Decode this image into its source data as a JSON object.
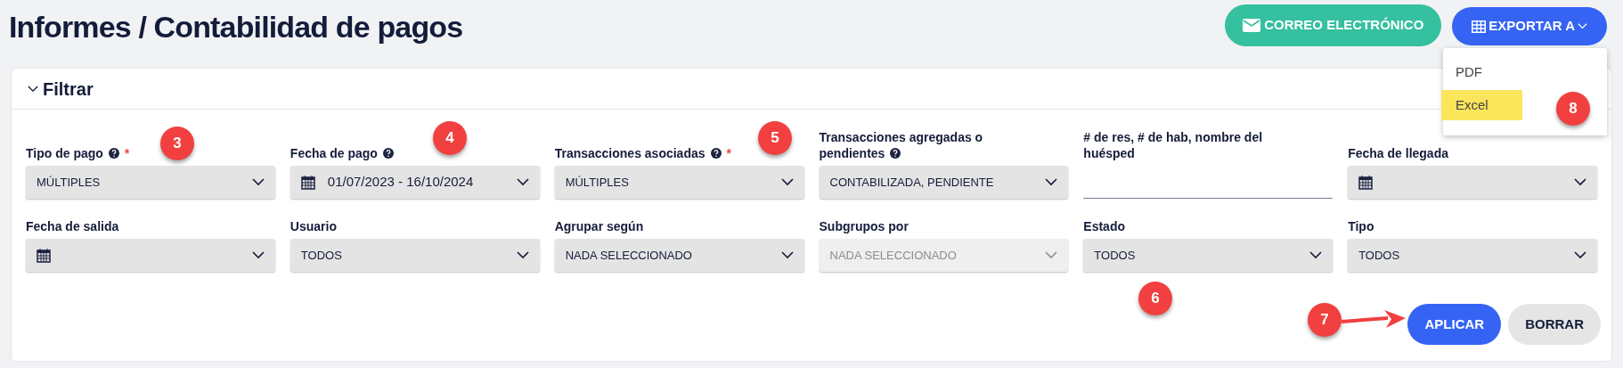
{
  "breadcrumb": [
    "Informes",
    "/ Contabilidad de pagos"
  ],
  "actions": [
    {
      "label": "CORREO ELECTRÓNICO",
      "kind": "email"
    },
    {
      "label": "EXPORTAR A",
      "kind": "export"
    }
  ],
  "export_menu": [
    {
      "label": "PDF",
      "highlighted": false
    },
    {
      "label": "Excel",
      "highlighted": true
    }
  ],
  "filter_panel": {
    "title": "Filtrar",
    "expanded": true,
    "fields": [
      {
        "label": "Tipo de pago",
        "help": true,
        "required_mark": "*",
        "kind": "select",
        "value": "MÚLTIPLES",
        "disabled": false
      },
      {
        "label": "Fecha de pago",
        "help": true,
        "kind": "date",
        "value": "01/07/2023 - 16/10/2024",
        "disabled": false
      },
      {
        "label": "Transacciones asociadas",
        "help": true,
        "required_mark": "*",
        "kind": "select",
        "value": "MÚLTIPLES",
        "disabled": false
      },
      {
        "label": "Transacciones agregadas o pendientes",
        "help": true,
        "kind": "select",
        "value": "CONTABILIZADA, PENDIENTE",
        "disabled": false
      },
      {
        "label": "# de res, # de hab, nombre del huésped",
        "help": false,
        "kind": "text",
        "disabled": false
      },
      {
        "label": "Fecha de llegada",
        "help": false,
        "kind": "date",
        "disabled": false
      },
      {
        "label": "Fecha de salida",
        "help": false,
        "kind": "date",
        "disabled": false
      },
      {
        "label": "Usuario",
        "help": false,
        "kind": "select",
        "value": "TODOS",
        "disabled": false
      },
      {
        "label": "Agrupar según",
        "help": false,
        "kind": "select",
        "value": "NADA SELECCIONADO",
        "disabled": false
      },
      {
        "label": "Subgrupos por",
        "help": false,
        "kind": "select",
        "value": "NADA SELECCIONADO",
        "disabled": true
      },
      {
        "label": "Estado",
        "help": false,
        "kind": "select",
        "value": "TODOS",
        "disabled": false
      },
      {
        "label": "Tipo",
        "help": false,
        "kind": "select",
        "value": "TODOS",
        "disabled": false
      }
    ],
    "buttons": [
      {
        "label": "APLICAR",
        "kind": "primary"
      },
      {
        "label": "BORRAR",
        "kind": "secondary"
      }
    ]
  },
  "callouts": [
    "3",
    "4",
    "5",
    "6",
    "7",
    "8"
  ]
}
